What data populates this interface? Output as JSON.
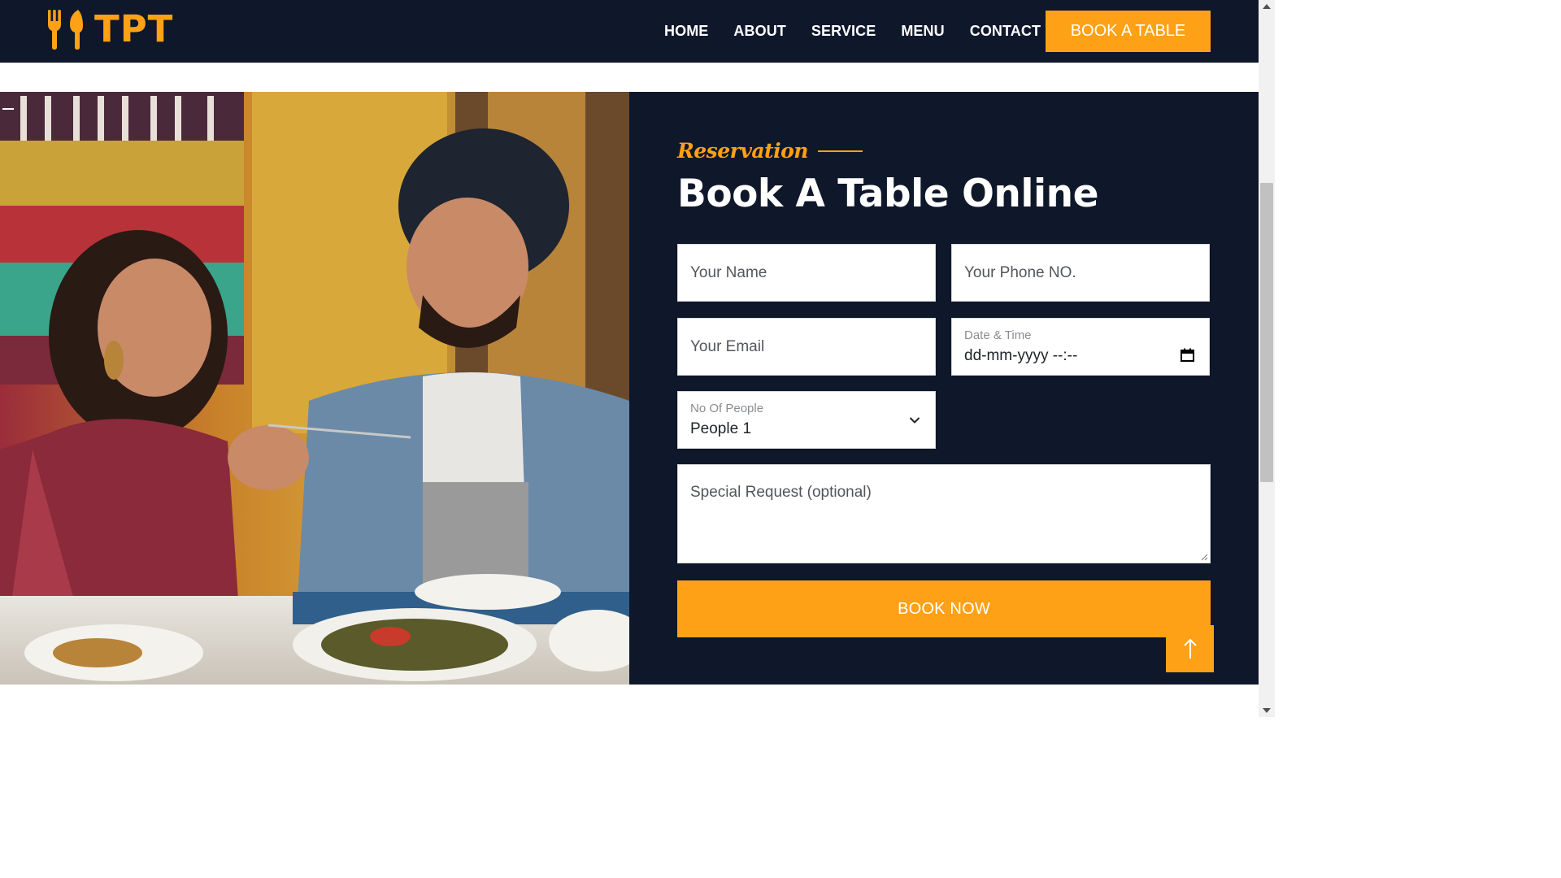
{
  "brand": {
    "name": "TPT",
    "icon": "utensils-icon",
    "accent_color": "#fea116",
    "dark_color": "#0f172b"
  },
  "nav": {
    "items": [
      {
        "label": "HOME"
      },
      {
        "label": "ABOUT"
      },
      {
        "label": "SERVICE"
      },
      {
        "label": "MENU"
      },
      {
        "label": "CONTACT"
      }
    ],
    "cta_label": "BOOK A TABLE"
  },
  "reservation": {
    "subtitle": "Reservation",
    "title": "Book A Table Online",
    "fields": {
      "name_placeholder": "Your Name",
      "phone_placeholder": "Your Phone NO.",
      "email_placeholder": "Your Email",
      "datetime_label": "Date & Time",
      "datetime_value": "dd-mm-yyyy --:--",
      "people_label": "No Of People",
      "people_value": "People 1",
      "request_placeholder": "Special Request (optional)"
    },
    "submit_label": "BOOK NOW"
  },
  "back_to_top_icon": "arrow-up-icon"
}
